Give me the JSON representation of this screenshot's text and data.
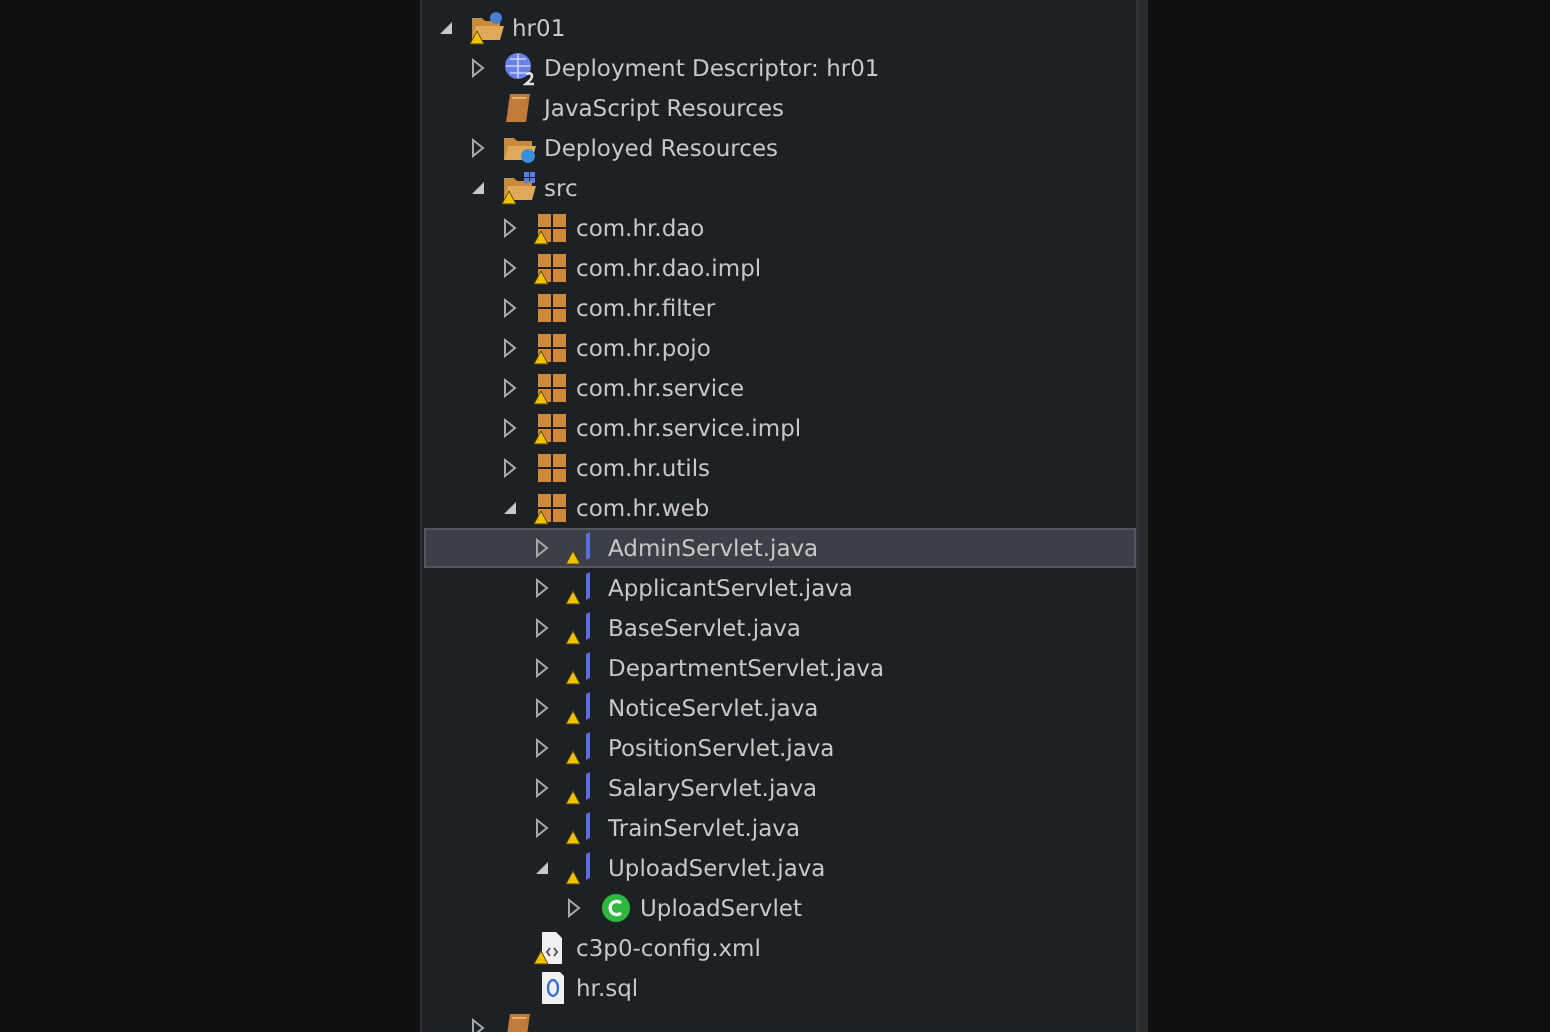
{
  "tree": [
    {
      "label": "hr01",
      "kind": "project",
      "warning": true,
      "expanded": true,
      "selected": false,
      "children": [
        {
          "label": "Deployment Descriptor: hr01",
          "kind": "descriptor",
          "warning": false,
          "expanded": false,
          "selected": false
        },
        {
          "label": "JavaScript Resources",
          "kind": "js-resources",
          "warning": false,
          "selected": false
        },
        {
          "label": "Deployed Resources",
          "kind": "deployed",
          "warning": false,
          "expanded": false,
          "selected": false
        },
        {
          "label": "src",
          "kind": "src-folder",
          "warning": true,
          "expanded": true,
          "selected": false,
          "children": [
            {
              "label": "com.hr.dao",
              "kind": "package",
              "warning": true,
              "expanded": false,
              "selected": false
            },
            {
              "label": "com.hr.dao.impl",
              "kind": "package",
              "warning": true,
              "expanded": false,
              "selected": false
            },
            {
              "label": "com.hr.filter",
              "kind": "package",
              "warning": false,
              "expanded": false,
              "selected": false
            },
            {
              "label": "com.hr.pojo",
              "kind": "package",
              "warning": true,
              "expanded": false,
              "selected": false
            },
            {
              "label": "com.hr.service",
              "kind": "package",
              "warning": true,
              "expanded": false,
              "selected": false
            },
            {
              "label": "com.hr.service.impl",
              "kind": "package",
              "warning": true,
              "expanded": false,
              "selected": false
            },
            {
              "label": "com.hr.utils",
              "kind": "package",
              "warning": false,
              "expanded": false,
              "selected": false
            },
            {
              "label": "com.hr.web",
              "kind": "package",
              "warning": true,
              "expanded": true,
              "selected": false,
              "children": [
                {
                  "label": "AdminServlet.java",
                  "kind": "java-file",
                  "warning": true,
                  "expanded": false,
                  "selected": true
                },
                {
                  "label": "ApplicantServlet.java",
                  "kind": "java-file",
                  "warning": true,
                  "expanded": false,
                  "selected": false
                },
                {
                  "label": "BaseServlet.java",
                  "kind": "java-file",
                  "warning": true,
                  "expanded": false,
                  "selected": false
                },
                {
                  "label": "DepartmentServlet.java",
                  "kind": "java-file",
                  "warning": true,
                  "expanded": false,
                  "selected": false
                },
                {
                  "label": "NoticeServlet.java",
                  "kind": "java-file",
                  "warning": true,
                  "expanded": false,
                  "selected": false
                },
                {
                  "label": "PositionServlet.java",
                  "kind": "java-file",
                  "warning": true,
                  "expanded": false,
                  "selected": false
                },
                {
                  "label": "SalaryServlet.java",
                  "kind": "java-file",
                  "warning": true,
                  "expanded": false,
                  "selected": false
                },
                {
                  "label": "TrainServlet.java",
                  "kind": "java-file",
                  "warning": true,
                  "expanded": false,
                  "selected": false
                },
                {
                  "label": "UploadServlet.java",
                  "kind": "java-file",
                  "warning": true,
                  "expanded": true,
                  "selected": false,
                  "children": [
                    {
                      "label": "UploadServlet",
                      "kind": "class",
                      "warning": false,
                      "expanded": false,
                      "selected": false
                    }
                  ]
                }
              ]
            },
            {
              "label": "c3p0-config.xml",
              "kind": "xml",
              "warning": true,
              "selected": false
            },
            {
              "label": "hr.sql",
              "kind": "sql",
              "warning": false,
              "selected": false
            }
          ]
        },
        {
          "kind": "libraries",
          "warning": false,
          "expanded": false,
          "selected": false
        }
      ]
    }
  ]
}
